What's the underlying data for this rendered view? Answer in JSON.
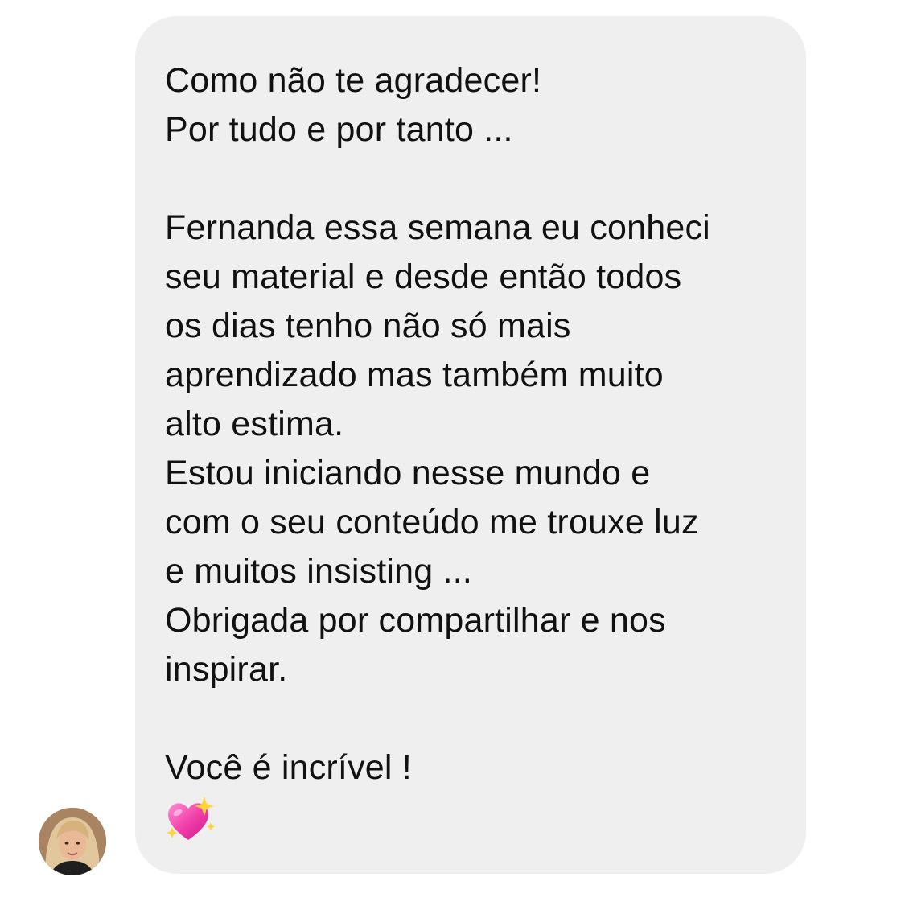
{
  "message": {
    "lines": [
      "Como não te agradecer!",
      "Por tudo e por tanto ...",
      "",
      "Fernanda essa semana eu conheci",
      "seu material e desde então todos",
      "os dias tenho não só mais",
      "aprendizado mas também muito",
      "alto estima.",
      "Estou iniciando nesse mundo e",
      "com o seu conteúdo me trouxe luz",
      "e muitos insisting ...",
      "Obrigada por compartilhar e nos",
      "inspirar.",
      "",
      "Você é incrível !"
    ],
    "emoji": "sparkling-heart-icon",
    "bubble_color": "#efefef",
    "text_color": "#111111"
  },
  "avatar": {
    "icon": "avatar"
  }
}
